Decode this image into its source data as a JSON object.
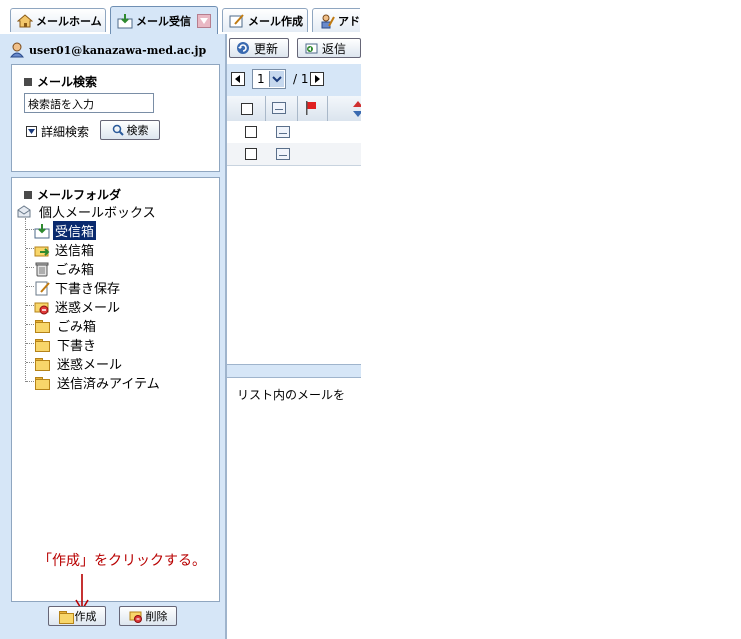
{
  "tabs": [
    {
      "label": "メールホーム",
      "icon": "home-icon"
    },
    {
      "label": "メール受信",
      "icon": "inbox-icon"
    },
    {
      "label": "メール作成",
      "icon": "compose-icon"
    },
    {
      "label": "アドレ",
      "icon": "address-book-icon"
    }
  ],
  "user": {
    "email": "user01@kanazawa-med.ac.jp"
  },
  "search": {
    "title": "メール検索",
    "placeholder": "検索語を入力",
    "advanced_label": "詳細検索",
    "search_button": "検索"
  },
  "folders": {
    "title": "メールフォルダ",
    "root": "個人メールボックス",
    "items": [
      {
        "label": "受信箱",
        "selected": true,
        "icon": "inbox-icon"
      },
      {
        "label": "送信箱",
        "icon": "outbox-icon"
      },
      {
        "label": "ごみ箱",
        "icon": "trash-icon"
      },
      {
        "label": "下書き保存",
        "icon": "draft-icon"
      },
      {
        "label": "迷惑メール",
        "icon": "spam-icon"
      },
      {
        "label": "ごみ箱",
        "icon": "folder-icon"
      },
      {
        "label": "下書き",
        "icon": "folder-icon"
      },
      {
        "label": "迷惑メール",
        "icon": "folder-icon"
      },
      {
        "label": "送信済みアイテム",
        "icon": "folder-icon"
      }
    ],
    "create_button": "作成",
    "delete_button": "削除"
  },
  "toolbar": {
    "refresh_label": "更新",
    "reply_label": "返信"
  },
  "pager": {
    "page": "1",
    "total": "/ 1"
  },
  "preview": {
    "text": "リスト内のメールを"
  },
  "annotation": {
    "text": "「作成」をクリックする。"
  },
  "colors": {
    "accent": "#d6e6f7",
    "selected": "#0a2a6e",
    "annotation": "#b80000"
  }
}
